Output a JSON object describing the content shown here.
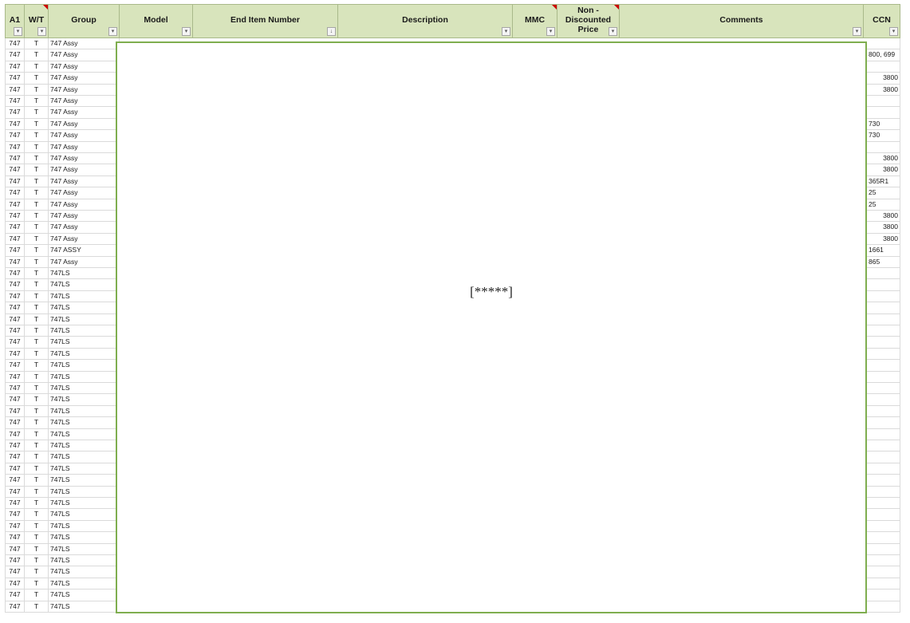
{
  "headers": [
    {
      "key": "a1",
      "label": "A1",
      "filter": "▾",
      "note": false
    },
    {
      "key": "wt",
      "label": "W/T",
      "filter": "▾",
      "note": true
    },
    {
      "key": "group",
      "label": "Group",
      "filter": "▾",
      "note": false
    },
    {
      "key": "model",
      "label": "Model",
      "filter": "▾",
      "note": false
    },
    {
      "key": "end_item",
      "label": "End Item Number",
      "filter": "↓",
      "note": false
    },
    {
      "key": "description",
      "label": "Description",
      "filter": "▾",
      "note": false
    },
    {
      "key": "mmc",
      "label": "MMC",
      "filter": "▾",
      "note": true
    },
    {
      "key": "price",
      "label": "Non -\nDiscounted\nPrice",
      "filter": "▾",
      "note": true
    },
    {
      "key": "comments",
      "label": "Comments",
      "filter": "▾",
      "note": false
    },
    {
      "key": "ccn",
      "label": "CCN",
      "filter": "▾",
      "note": false
    }
  ],
  "redaction_text": "[*****]",
  "rows": [
    {
      "a1": "747",
      "wt": "T",
      "group": "747 Assy",
      "ccn": "",
      "ccn_align": "right"
    },
    {
      "a1": "747",
      "wt": "T",
      "group": "747 Assy",
      "ccn": "800, 699",
      "ccn_align": "left"
    },
    {
      "a1": "747",
      "wt": "T",
      "group": "747 Assy",
      "ccn": "",
      "ccn_align": "right"
    },
    {
      "a1": "747",
      "wt": "T",
      "group": "747 Assy",
      "ccn": "3800",
      "ccn_align": "right"
    },
    {
      "a1": "747",
      "wt": "T",
      "group": "747 Assy",
      "ccn": "3800",
      "ccn_align": "right"
    },
    {
      "a1": "747",
      "wt": "T",
      "group": "747 Assy",
      "ccn": "",
      "ccn_align": "right"
    },
    {
      "a1": "747",
      "wt": "T",
      "group": "747 Assy",
      "ccn": "",
      "ccn_align": "right"
    },
    {
      "a1": "747",
      "wt": "T",
      "group": "747 Assy",
      "ccn": "730",
      "ccn_align": "left"
    },
    {
      "a1": "747",
      "wt": "T",
      "group": "747 Assy",
      "ccn": "730",
      "ccn_align": "left"
    },
    {
      "a1": "747",
      "wt": "T",
      "group": "747 Assy",
      "ccn": "",
      "ccn_align": "right"
    },
    {
      "a1": "747",
      "wt": "T",
      "group": "747 Assy",
      "ccn": "3800",
      "ccn_align": "right"
    },
    {
      "a1": "747",
      "wt": "T",
      "group": "747 Assy",
      "ccn": "3800",
      "ccn_align": "right"
    },
    {
      "a1": "747",
      "wt": "T",
      "group": "747 Assy",
      "ccn": "365R1",
      "ccn_align": "left"
    },
    {
      "a1": "747",
      "wt": "T",
      "group": "747 Assy",
      "ccn": "25",
      "ccn_align": "left"
    },
    {
      "a1": "747",
      "wt": "T",
      "group": "747 Assy",
      "ccn": "25",
      "ccn_align": "left"
    },
    {
      "a1": "747",
      "wt": "T",
      "group": "747 Assy",
      "ccn": "3800",
      "ccn_align": "right"
    },
    {
      "a1": "747",
      "wt": "T",
      "group": "747 Assy",
      "ccn": "3800",
      "ccn_align": "right"
    },
    {
      "a1": "747",
      "wt": "T",
      "group": "747 Assy",
      "ccn": "3800",
      "ccn_align": "right"
    },
    {
      "a1": "747",
      "wt": "T",
      "group": "747 ASSY",
      "ccn": "1661",
      "ccn_align": "left"
    },
    {
      "a1": "747",
      "wt": "T",
      "group": "747 Assy",
      "ccn": "865",
      "ccn_align": "left"
    },
    {
      "a1": "747",
      "wt": "T",
      "group": "747LS",
      "ccn": "",
      "ccn_align": "right"
    },
    {
      "a1": "747",
      "wt": "T",
      "group": "747LS",
      "ccn": "",
      "ccn_align": "right"
    },
    {
      "a1": "747",
      "wt": "T",
      "group": "747LS",
      "ccn": "",
      "ccn_align": "right"
    },
    {
      "a1": "747",
      "wt": "T",
      "group": "747LS",
      "ccn": "",
      "ccn_align": "right"
    },
    {
      "a1": "747",
      "wt": "T",
      "group": "747LS",
      "ccn": "",
      "ccn_align": "right"
    },
    {
      "a1": "747",
      "wt": "T",
      "group": "747LS",
      "ccn": "",
      "ccn_align": "right"
    },
    {
      "a1": "747",
      "wt": "T",
      "group": "747LS",
      "ccn": "",
      "ccn_align": "right"
    },
    {
      "a1": "747",
      "wt": "T",
      "group": "747LS",
      "ccn": "",
      "ccn_align": "right"
    },
    {
      "a1": "747",
      "wt": "T",
      "group": "747LS",
      "ccn": "",
      "ccn_align": "right"
    },
    {
      "a1": "747",
      "wt": "T",
      "group": "747LS",
      "ccn": "",
      "ccn_align": "right"
    },
    {
      "a1": "747",
      "wt": "T",
      "group": "747LS",
      "ccn": "",
      "ccn_align": "right"
    },
    {
      "a1": "747",
      "wt": "T",
      "group": "747LS",
      "ccn": "",
      "ccn_align": "right"
    },
    {
      "a1": "747",
      "wt": "T",
      "group": "747LS",
      "ccn": "",
      "ccn_align": "right"
    },
    {
      "a1": "747",
      "wt": "T",
      "group": "747LS",
      "ccn": "",
      "ccn_align": "right"
    },
    {
      "a1": "747",
      "wt": "T",
      "group": "747LS",
      "ccn": "",
      "ccn_align": "right"
    },
    {
      "a1": "747",
      "wt": "T",
      "group": "747LS",
      "ccn": "",
      "ccn_align": "right"
    },
    {
      "a1": "747",
      "wt": "T",
      "group": "747LS",
      "ccn": "",
      "ccn_align": "right"
    },
    {
      "a1": "747",
      "wt": "T",
      "group": "747LS",
      "ccn": "",
      "ccn_align": "right"
    },
    {
      "a1": "747",
      "wt": "T",
      "group": "747LS",
      "ccn": "",
      "ccn_align": "right"
    },
    {
      "a1": "747",
      "wt": "T",
      "group": "747LS",
      "ccn": "",
      "ccn_align": "right"
    },
    {
      "a1": "747",
      "wt": "T",
      "group": "747LS",
      "ccn": "",
      "ccn_align": "right"
    },
    {
      "a1": "747",
      "wt": "T",
      "group": "747LS",
      "ccn": "",
      "ccn_align": "right"
    },
    {
      "a1": "747",
      "wt": "T",
      "group": "747LS",
      "ccn": "",
      "ccn_align": "right"
    },
    {
      "a1": "747",
      "wt": "T",
      "group": "747LS",
      "ccn": "",
      "ccn_align": "right"
    },
    {
      "a1": "747",
      "wt": "T",
      "group": "747LS",
      "ccn": "",
      "ccn_align": "right"
    },
    {
      "a1": "747",
      "wt": "T",
      "group": "747LS",
      "ccn": "",
      "ccn_align": "right"
    },
    {
      "a1": "747",
      "wt": "T",
      "group": "747LS",
      "ccn": "",
      "ccn_align": "right"
    },
    {
      "a1": "747",
      "wt": "T",
      "group": "747LS",
      "ccn": "",
      "ccn_align": "right"
    },
    {
      "a1": "747",
      "wt": "T",
      "group": "747LS",
      "ccn": "",
      "ccn_align": "right"
    },
    {
      "a1": "747",
      "wt": "T",
      "group": "747LS",
      "ccn": "",
      "ccn_align": "right"
    }
  ]
}
